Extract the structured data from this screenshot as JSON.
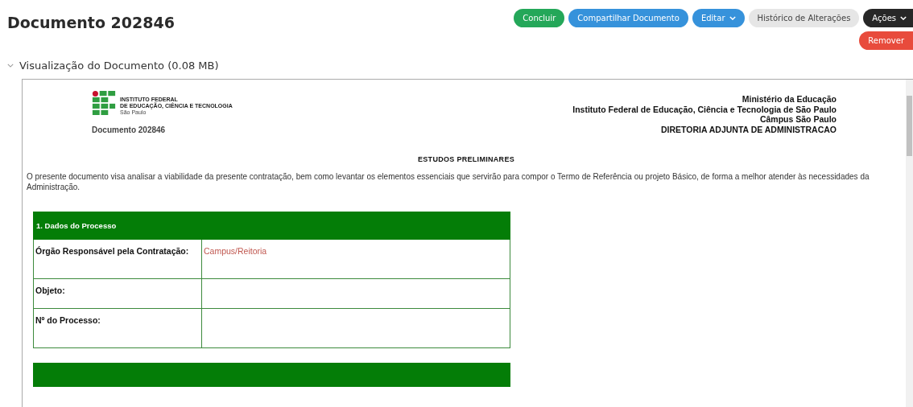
{
  "title": "Documento 202846",
  "buttons": [
    {
      "label": "Concluir",
      "kind": "success",
      "caret": false
    },
    {
      "label": "Compartilhar Documento",
      "kind": "primary",
      "caret": false
    },
    {
      "label": "Editar",
      "kind": "primary",
      "caret": true
    },
    {
      "label": "Histórico de Alterações",
      "kind": "light",
      "caret": false
    },
    {
      "label": "Ações",
      "kind": "dark",
      "caret": true
    }
  ],
  "remove_button": "Remover",
  "preview": {
    "label": "Visualização do Documento (0.08 MB)",
    "expanded": true
  },
  "document": {
    "logo_lines": [
      "INSTITUTO FEDERAL",
      "DE EDUCAÇÃO, CIÊNCIA E TECNOLOGIA"
    ],
    "logo_campus": "São Paulo",
    "doc_number": "Documento 202846",
    "header_lines": [
      "Ministério da Educação",
      "Instituto Federal de Educação, Ciência e Tecnologia de São Paulo",
      "Câmpus São Paulo",
      "DIRETORIA ADJUNTA DE ADMINISTRACAO"
    ],
    "heading": "ESTUDOS PRELIMINARES",
    "intro": "O presente documento visa analisar a viabilidade da presente contratação, bem como levantar os elementos essenciais que servirão para compor o Termo de Referência ou projeto Básico, de forma a melhor atender às necessidades da Administração.",
    "table": {
      "title": "1. Dados do Processo",
      "rows": [
        {
          "label": "Órgão Responsável pela Contratação:",
          "value": "Campus/Reitoria"
        },
        {
          "label": "Objeto:"
        },
        {
          "label": "Nº do Processo:"
        }
      ]
    }
  }
}
